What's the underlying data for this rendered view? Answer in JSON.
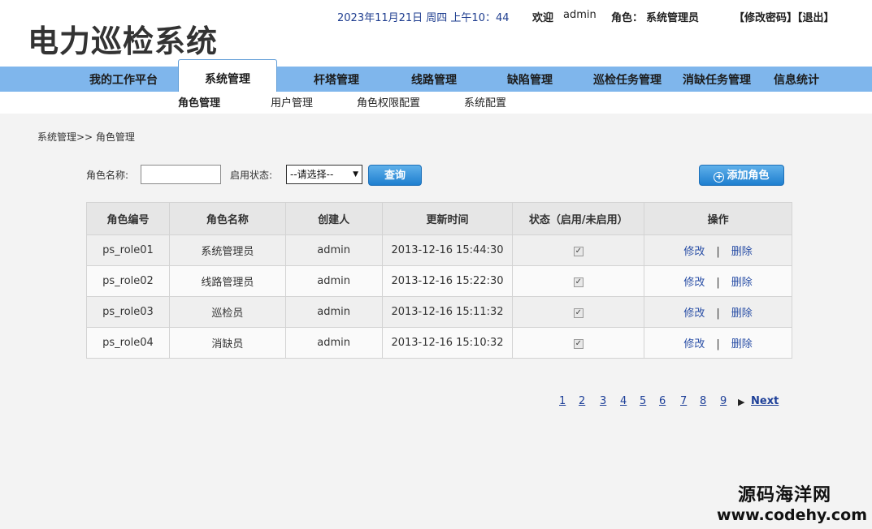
{
  "header": {
    "title": "电力巡检系统",
    "datetime": "2023年11月21日 周四 上午10：44",
    "welcome_label": "欢迎",
    "username": "admin",
    "role_label": "角色：",
    "role_value": "系统管理员",
    "change_password": "【修改密码】",
    "logout": "【退出】"
  },
  "nav": {
    "items": [
      {
        "label": "我的工作平台"
      },
      {
        "label": "系统管理"
      },
      {
        "label": "杆塔管理"
      },
      {
        "label": "线路管理"
      },
      {
        "label": "缺陷管理"
      },
      {
        "label": "巡检任务管理"
      },
      {
        "label": "消缺任务管理"
      },
      {
        "label": "信息统计"
      }
    ],
    "active": "系统管理"
  },
  "subnav": {
    "items": [
      {
        "label": "角色管理"
      },
      {
        "label": "用户管理"
      },
      {
        "label": "角色权限配置"
      },
      {
        "label": "系统配置"
      }
    ],
    "active": "角色管理"
  },
  "breadcrumb": "系统管理>> 角色管理",
  "filter": {
    "name_label": "角色名称:",
    "name_value": "",
    "status_label": "启用状态:",
    "status_selected": "--请选择--",
    "query_button": "查询",
    "add_button": "添加角色"
  },
  "table": {
    "headers": [
      "角色编号",
      "角色名称",
      "创建人",
      "更新时间",
      "状态（启用/未启用）",
      "操作"
    ],
    "rows": [
      {
        "id": "ps_role01",
        "name": "系统管理员",
        "creator": "admin",
        "updated": "2013-12-16 15:44:30",
        "enabled": true
      },
      {
        "id": "ps_role02",
        "name": "线路管理员",
        "creator": "admin",
        "updated": "2013-12-16 15:22:30",
        "enabled": true
      },
      {
        "id": "ps_role03",
        "name": "巡检员",
        "creator": "admin",
        "updated": "2013-12-16 15:11:32",
        "enabled": true
      },
      {
        "id": "ps_role04",
        "name": "消缺员",
        "creator": "admin",
        "updated": "2013-12-16 15:10:32",
        "enabled": true
      }
    ],
    "edit_label": "修改",
    "separator": "|",
    "delete_label": "删除"
  },
  "pagination": {
    "pages": [
      "1",
      "2",
      "3",
      "4",
      "5",
      "6",
      "7",
      "8",
      "9"
    ],
    "next_label": "Next"
  },
  "watermark": {
    "line1": "源码海洋网",
    "line2": "www.codehy.com"
  }
}
